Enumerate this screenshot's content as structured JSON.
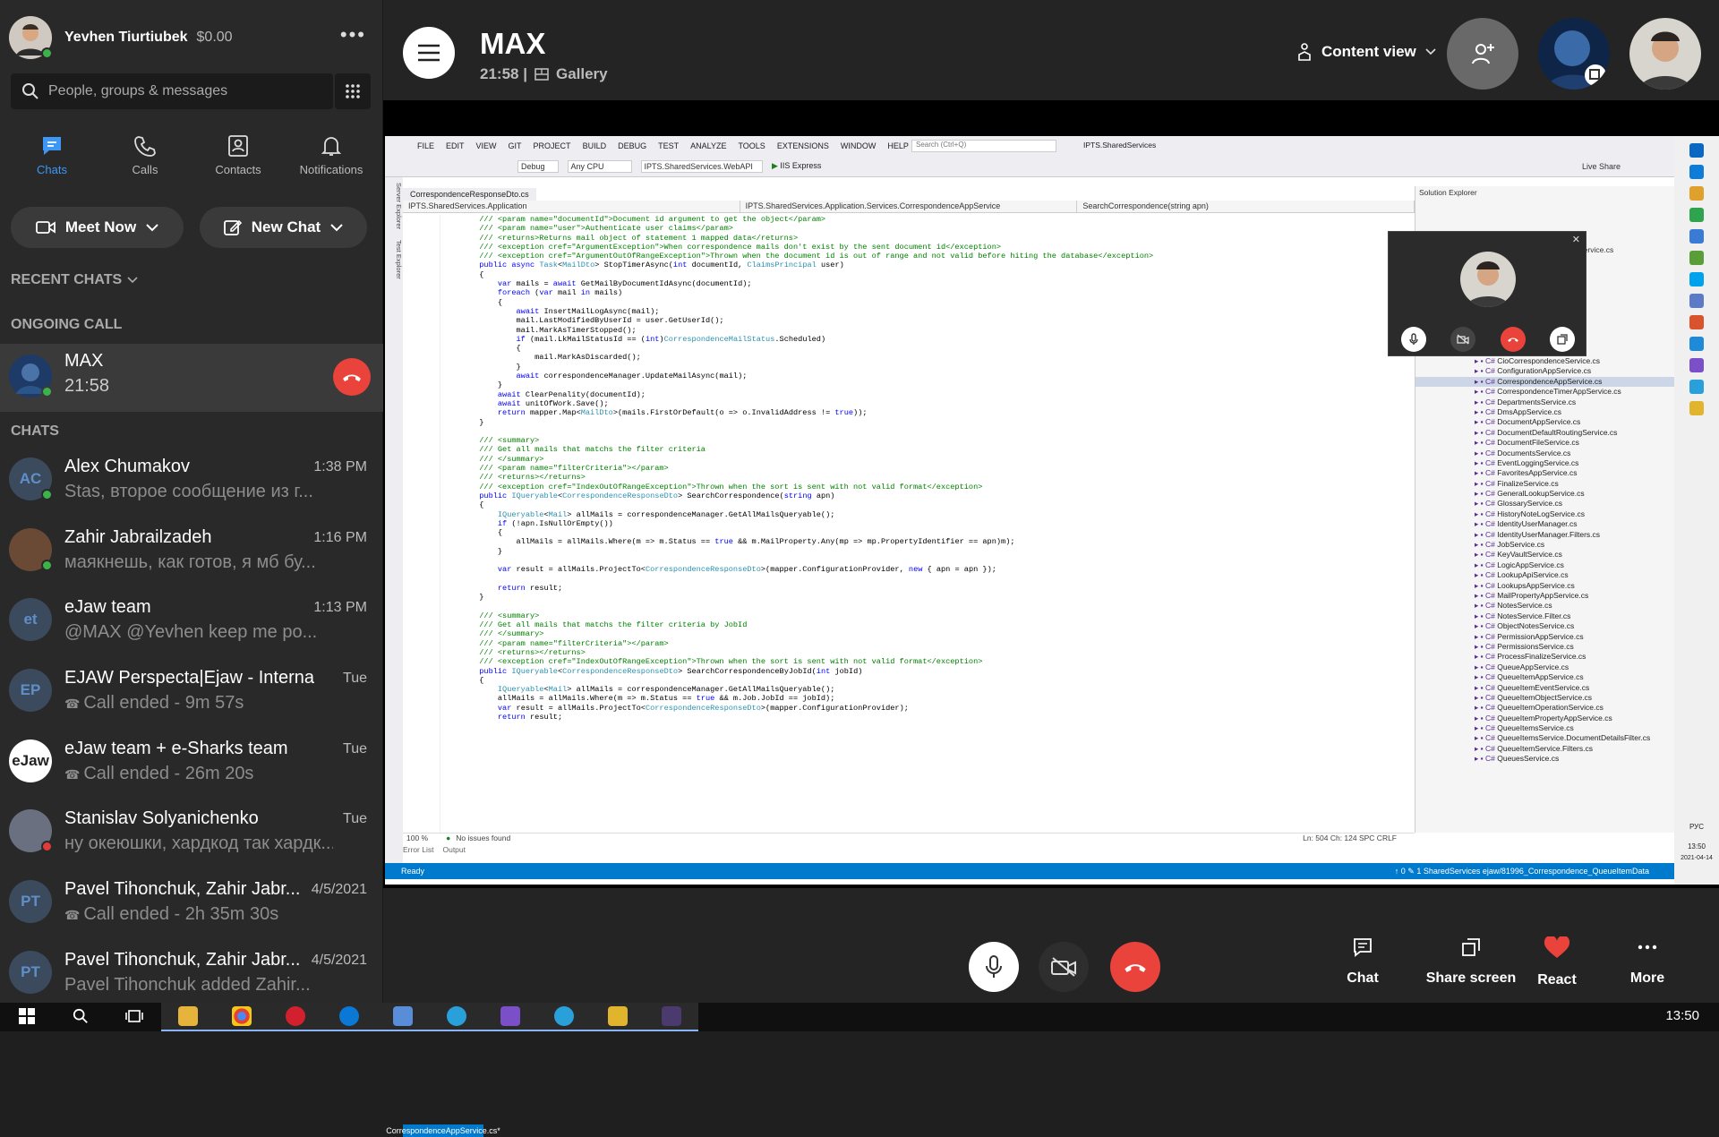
{
  "sidebar": {
    "profile": {
      "name": "Yevhen Tiurtiubek",
      "balance": "$0.00"
    },
    "search_placeholder": "People, groups & messages",
    "nav": [
      {
        "label": "Chats",
        "icon": "chat-icon"
      },
      {
        "label": "Calls",
        "icon": "phone-icon"
      },
      {
        "label": "Contacts",
        "icon": "contacts-icon"
      },
      {
        "label": "Notifications",
        "icon": "bell-icon"
      }
    ],
    "meet_now": "Meet Now",
    "new_chat": "New Chat",
    "recent_chats": "RECENT CHATS",
    "ongoing_call": "ONGOING CALL",
    "call": {
      "name": "MAX",
      "time": "21:58"
    },
    "chats_header": "CHATS",
    "chats": [
      {
        "title": "Alex Chumakov",
        "msg": "Stas, второе сообщение из г...",
        "time": "1:38 PM",
        "initials": "AC",
        "color": "#3c4a5e"
      },
      {
        "title": "Zahir Jabrailzadeh",
        "msg": "маякнешь, как готов, я мб бу...",
        "time": "1:16 PM",
        "initials": "",
        "color": "#6b4a35"
      },
      {
        "title": "eJaw team",
        "msg": "@MAX @Yevhen keep me po...",
        "time": "1:13 PM",
        "initials": "et",
        "color": "#3c4a5e"
      },
      {
        "title": "EJAW Perspecta|Ejaw - Internal",
        "msg": "Call ended - 9m 57s",
        "time": "Tue",
        "initials": "EP",
        "color": "#3c4a5e"
      },
      {
        "title": "eJaw team + e-Sharks team",
        "msg": "Call ended - 26m 20s",
        "time": "Tue",
        "initials": "eJaw",
        "color": "#ffffff"
      },
      {
        "title": "Stanislav Solyanichenko",
        "msg": "ну океюшки, хардкод так хардк...",
        "time": "Tue",
        "initials": "",
        "color": "#6a7080"
      },
      {
        "title": "Pavel Tihonchuk, Zahir Jabr...",
        "msg": "Call ended - 2h 35m 30s",
        "time": "4/5/2021",
        "initials": "PT",
        "color": "#3c4a5e"
      },
      {
        "title": "Pavel Tihonchuk, Zahir Jabr...",
        "msg": "Pavel Tihonchuk added Zahir...",
        "time": "4/5/2021",
        "initials": "PT",
        "color": "#3c4a5e"
      }
    ]
  },
  "call_header": {
    "title": "MAX",
    "elapsed": "21:58 |",
    "layout": "Gallery",
    "content_view": "Content view"
  },
  "vs": {
    "menu": [
      "FILE",
      "EDIT",
      "VIEW",
      "GIT",
      "PROJECT",
      "BUILD",
      "DEBUG",
      "TEST",
      "ANALYZE",
      "TOOLS",
      "EXTENSIONS",
      "WINDOW",
      "HELP"
    ],
    "search": "Search (Ctrl+Q)",
    "solution": "IPTS.SharedServices",
    "config": "Debug",
    "platform": "Any CPU",
    "startup": "IPTS.SharedServices.WebAPI",
    "run": "IIS Express",
    "live_share": "Live Share",
    "tabs": [
      "CorrespondenceResponseDto.cs",
      "CorrespondenceAppService.cs*"
    ],
    "nav": [
      "IPTS.SharedServices.Application",
      "IPTS.SharedServices.Application.Services.CorrespondenceAppService",
      "SearchCorrespondence(string apn)"
    ],
    "side_tabs": [
      "Server Explorer",
      "Test Explorer"
    ],
    "solution_explorer": "Solution Explorer",
    "zoom": "100 %",
    "issues": "No issues found",
    "position": "Ln: 504   Ch: 124   SPC   CRLF",
    "bottom_tabs": [
      "Error List",
      "Output"
    ],
    "status": "Ready",
    "status_right": "↑ 0   ✎ 1   SharedServices   ejaw/81996_Correspondence_QueueItemData",
    "files": [
      "CioCorrespondenceService.cs",
      "ConfigurationAppService.cs",
      "CorrespondenceAppService.cs",
      "CorrespondenceTimerAppService.cs",
      "DepartmentsService.cs",
      "DmsAppService.cs",
      "DocumentAppService.cs",
      "DocumentDefaultRoutingService.cs",
      "DocumentFileService.cs",
      "DocumentsService.cs",
      "EventLoggingService.cs",
      "FavoritesAppService.cs",
      "FinalizeService.cs",
      "GeneralLookupService.cs",
      "GlossaryService.cs",
      "HistoryNoteLogService.cs",
      "IdentityUserManager.cs",
      "IdentityUserManager.Filters.cs",
      "JobService.cs",
      "KeyVaultService.cs",
      "LogicAppService.cs",
      "LookupApiService.cs",
      "LookupsAppService.cs",
      "MailPropertyAppService.cs",
      "NotesService.cs",
      "NotesService.Filter.cs",
      "ObjectNotesService.cs",
      "PermissionAppService.cs",
      "PermissionsService.cs",
      "ProcessFinalizeService.cs",
      "QueueAppService.cs",
      "QueueItemAppService.cs",
      "QueueItemEventService.cs",
      "QueueItemObjectService.cs",
      "QueueItemOperationService.cs",
      "QueueItemPropertyAppService.cs",
      "QueueItemsService.cs",
      "QueueItemsService.DocumentDetailsFilter.cs",
      "QueueItemService.Filters.cs",
      "QueuesService.cs"
    ],
    "selected_file": "CorrespondenceAppService.cs",
    "partial_file": "Service.cs",
    "taskbar_time": "13:50",
    "taskbar_date": "2021-04-14",
    "lang": "РУС"
  },
  "controls": {
    "chat": "Chat",
    "share": "Share screen",
    "react": "React",
    "more": "More"
  },
  "taskbar": {
    "clock": "13:50"
  }
}
